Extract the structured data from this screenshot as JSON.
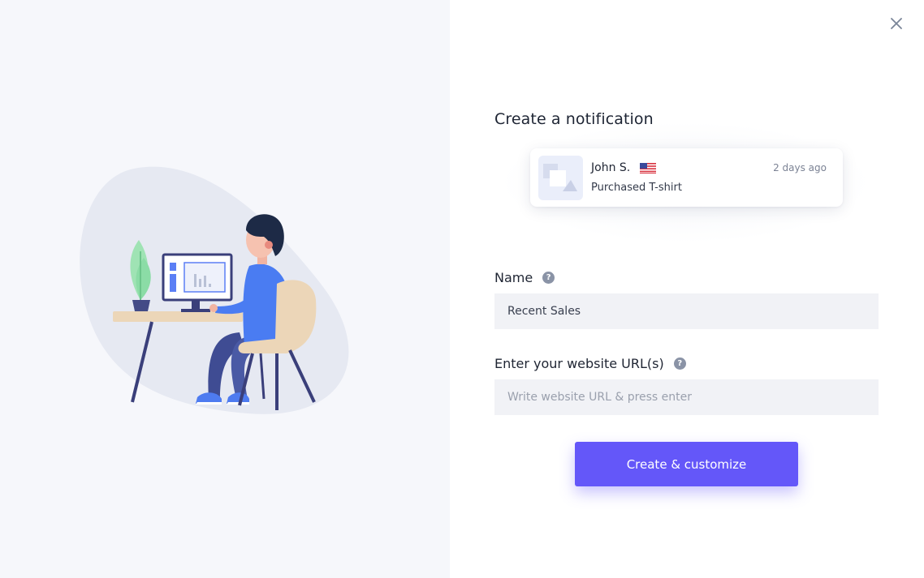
{
  "dialog": {
    "title": "Create a notification",
    "close_icon": "close-icon"
  },
  "preview": {
    "name": "John S.",
    "flag_icon": "us-flag-icon",
    "time": "2 days ago",
    "action": "Purchased T-shirt",
    "thumbnail_icon": "image-placeholder-icon"
  },
  "form": {
    "name": {
      "label": "Name",
      "value": "Recent Sales",
      "help_icon": "help-icon"
    },
    "url": {
      "label": "Enter your website URL(s)",
      "placeholder": "Write website URL & press enter",
      "value": "",
      "help_icon": "help-icon"
    },
    "submit_label": "Create & customize"
  },
  "colors": {
    "accent": "#6457f9",
    "left_panel_bg": "#f6f7fb",
    "input_bg": "#f1f2f6"
  }
}
